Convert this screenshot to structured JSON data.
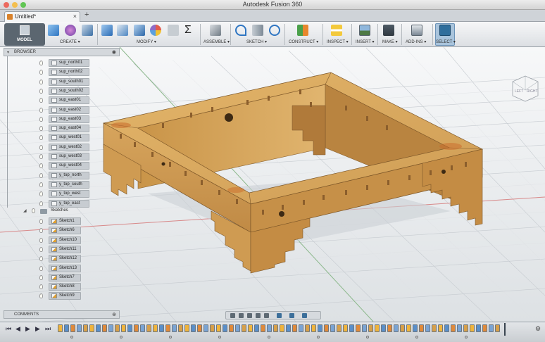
{
  "window": {
    "title": "Autodesk Fusion 360"
  },
  "tabs": [
    {
      "label": "Untitled*"
    }
  ],
  "toolbar": {
    "workspace_label": "MODEL",
    "groups": [
      {
        "label": "CREATE"
      },
      {
        "label": "MODIFY"
      },
      {
        "label": "ASSEMBLE"
      },
      {
        "label": "SKETCH"
      },
      {
        "label": "CONSTRUCT"
      },
      {
        "label": "INSPECT"
      },
      {
        "label": "INSERT"
      },
      {
        "label": "MAKE"
      },
      {
        "label": "ADD-INS"
      },
      {
        "label": "SELECT"
      }
    ],
    "sigma_glyph": "Σ"
  },
  "viewcube": {
    "face_left": "LEFT",
    "face_right": "RIGHT"
  },
  "browser": {
    "title": "BROWSER",
    "bodies": [
      "sup_north01",
      "sup_north02",
      "sup_south01",
      "sup_south02",
      "sup_east01",
      "sup_east02",
      "sup_east03",
      "sup_east04",
      "sup_west01",
      "sup_west02",
      "sup_west03",
      "sup_west04",
      "y_top_north",
      "y_top_south",
      "y_top_west",
      "y_top_east"
    ],
    "sketch_folder": "Sketches",
    "sketches": [
      "Sketch1",
      "Sketch6",
      "Sketch10",
      "Sketch11",
      "Sketch12",
      "Sketch13",
      "Sketch7",
      "Sketch8",
      "Sketch9"
    ]
  },
  "comments": {
    "title": "COMMENTS"
  },
  "colors": {
    "wood": "#d9a95d",
    "wood_dark": "#b98440",
    "accent_select": "#3f8fd2",
    "orange": "#e28a2b",
    "grid": "#c9ced3"
  }
}
